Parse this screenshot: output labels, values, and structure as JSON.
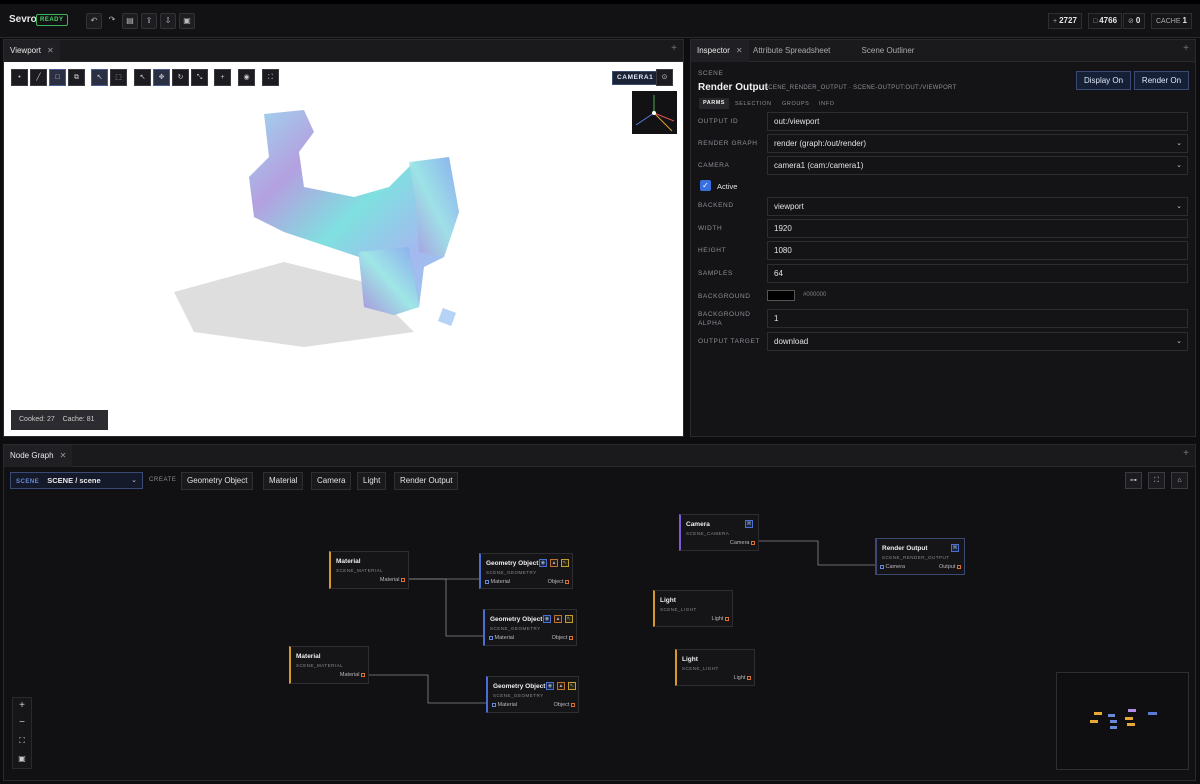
{
  "app": {
    "name": "Sevro",
    "status": "READY"
  },
  "stats": [
    {
      "icon": "+",
      "value": "2727"
    },
    {
      "icon": "□",
      "value": "4766"
    },
    {
      "icon": "⊘",
      "value": "0"
    },
    {
      "icon": "CACHE",
      "value": "1"
    }
  ],
  "viewport": {
    "tab": "Viewport",
    "camera_label": "CAMERA1",
    "cooked_label": "Cooked:",
    "cooked": "27",
    "cache_label": "Cache:",
    "cache": "81"
  },
  "inspector": {
    "tabs": [
      "Inspector",
      "Attribute Spreadsheet",
      "Scene Outliner"
    ],
    "category": "SCENE",
    "title": "Render Output",
    "path": "SCENE_RENDER_OUTPUT · SCENE-OUTPUT:OUT:/VIEWPORT",
    "display_btn": "Display On",
    "render_btn": "Render On",
    "subtabs": [
      "PARMS",
      "SELECTION",
      "GROUPS",
      "INFO"
    ],
    "params": [
      {
        "label": "OUTPUT ID",
        "value": "out:/viewport",
        "select": false
      },
      {
        "label": "RENDER GRAPH",
        "value": "render (graph:/out/render)",
        "select": true
      },
      {
        "label": "CAMERA",
        "value": "camera1 (cam:/camera1)",
        "select": true
      },
      {
        "label": "BACKEND",
        "value": "viewport",
        "select": true
      },
      {
        "label": "WIDTH",
        "value": "1920",
        "select": false
      },
      {
        "label": "HEIGHT",
        "value": "1080",
        "select": false
      },
      {
        "label": "SAMPLES",
        "value": "64",
        "select": false
      },
      {
        "label": "BACKGROUND",
        "value": "#000000",
        "select": false
      },
      {
        "label": "BACKGROUND ALPHA",
        "value": "1",
        "select": false
      },
      {
        "label": "OUTPUT TARGET",
        "value": "download",
        "select": true
      }
    ],
    "active_label": "Active",
    "active": true
  },
  "nodegraph": {
    "tab": "Node Graph",
    "scene_label": "SCENE",
    "scene_value": "SCENE / scene",
    "create_label": "CREATE",
    "create_buttons": [
      "Geometry Object",
      "Material",
      "Camera",
      "Light",
      "Render Output"
    ],
    "nodes": [
      {
        "title": "Material",
        "sub": "SCENE_MATERIAL",
        "out": "Material"
      },
      {
        "title": "Geometry Object",
        "sub": "SCENE_GEOMETRY",
        "in": "Material",
        "out": "Object"
      },
      {
        "title": "Geometry Object",
        "sub": "SCENE_GEOMETRY",
        "in": "Material",
        "out": "Object"
      },
      {
        "title": "Material",
        "sub": "SCENE_MATERIAL",
        "out": "Material"
      },
      {
        "title": "Geometry Object",
        "sub": "SCENE_GEOMETRY",
        "in": "Material",
        "out": "Object"
      },
      {
        "title": "Camera",
        "sub": "SCENE_CAMERA",
        "out": "Camera"
      },
      {
        "title": "Light",
        "sub": "SCENE_LIGHT",
        "out": "Light"
      },
      {
        "title": "Light",
        "sub": "SCENE_LIGHT",
        "out": "Light"
      },
      {
        "title": "Render Output",
        "sub": "SCENE_RENDER_OUTPUT",
        "in": "Camera",
        "out": "Output"
      }
    ]
  },
  "colors": {
    "accent": "#4a6fd0",
    "material": "#d89b2a",
    "camera": "#7d5ad6",
    "render": "#d04a6a",
    "port": "#e07030"
  }
}
